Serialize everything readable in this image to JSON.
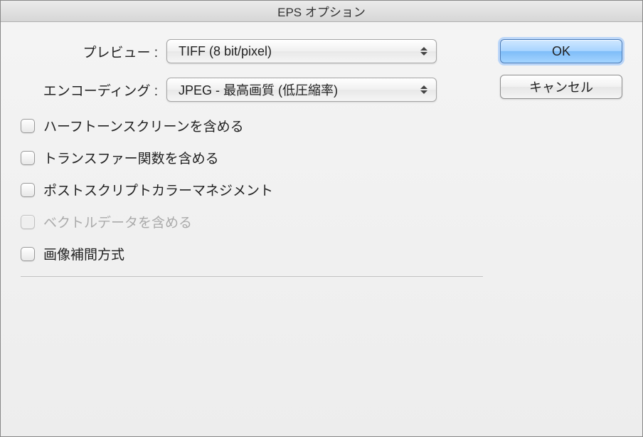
{
  "title": "EPS オプション",
  "preview": {
    "label": "プレビュー :",
    "value": "TIFF (8 bit/pixel)"
  },
  "encoding": {
    "label": "エンコーディング :",
    "value": "JPEG - 最高画質 (低圧縮率)"
  },
  "checkboxes": {
    "halftone": "ハーフトーンスクリーンを含める",
    "transfer": "トランスファー関数を含める",
    "postscript": "ポストスクリプトカラーマネジメント",
    "vector": "ベクトルデータを含める",
    "interpolation": "画像補間方式"
  },
  "buttons": {
    "ok": "OK",
    "cancel": "キャンセル"
  }
}
